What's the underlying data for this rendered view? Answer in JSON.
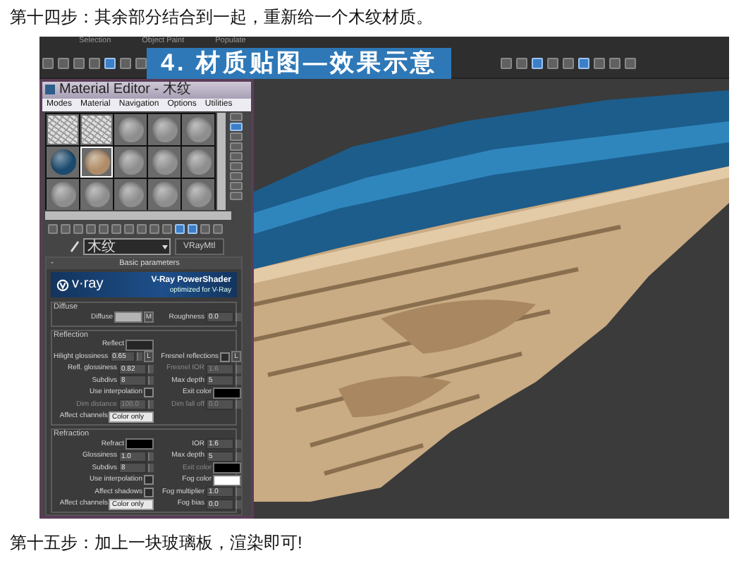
{
  "heading": "第十四步：其余部分结合到一起，重新给一个木纹材质。",
  "figure": {
    "banner": "4. 材质贴图—效果示意",
    "ribbon_tabs": [
      "Selection",
      "Object Paint",
      "Populate"
    ],
    "material_editor": {
      "title": "Material Editor - 木纹",
      "menu": [
        "Modes",
        "Material",
        "Navigation",
        "Options",
        "Utilities"
      ],
      "slots": [
        {
          "kind": "texture",
          "selected": false
        },
        {
          "kind": "texture",
          "selected": false
        },
        {
          "kind": "sphere",
          "color": "#8e8e8e",
          "selected": false
        },
        {
          "kind": "sphere",
          "color": "#8e8e8e",
          "selected": false
        },
        {
          "kind": "sphere",
          "color": "#8e8e8e",
          "selected": false
        },
        {
          "kind": "sphere",
          "color": "#1b4a6e",
          "selected": false
        },
        {
          "kind": "sphere",
          "color": "#b08d68",
          "selected": true
        },
        {
          "kind": "sphere",
          "color": "#8e8e8e",
          "selected": false
        },
        {
          "kind": "sphere",
          "color": "#8e8e8e",
          "selected": false
        },
        {
          "kind": "sphere",
          "color": "#8e8e8e",
          "selected": false
        },
        {
          "kind": "sphere",
          "color": "#8e8e8e",
          "selected": false
        },
        {
          "kind": "sphere",
          "color": "#8e8e8e",
          "selected": false
        },
        {
          "kind": "sphere",
          "color": "#8e8e8e",
          "selected": false
        },
        {
          "kind": "sphere",
          "color": "#8e8e8e",
          "selected": false
        },
        {
          "kind": "sphere",
          "color": "#8e8e8e",
          "selected": false
        }
      ],
      "material_name": "木纹",
      "material_type": "VRayMtl",
      "rollout": {
        "sign": "-",
        "title": "Basic parameters"
      },
      "vray_banner": {
        "logo": "v·ray",
        "title": "V-Ray PowerShader",
        "subtitle": "optimized for V-Ray"
      },
      "groups": [
        {
          "title": "Diffuse",
          "rows": [
            [
              {
                "label": "Diffuse",
                "kind": "color",
                "color": "#b4b4b4",
                "button": "M",
                "disabled": false
              },
              {
                "label": "Roughness",
                "kind": "spinner",
                "value": "0.0",
                "disabled": false
              }
            ]
          ]
        },
        {
          "title": "Reflection",
          "rows": [
            [
              {
                "label": "Reflect",
                "kind": "color",
                "color": "#262626",
                "disabled": false
              }
            ],
            [
              {
                "label": "Hilight glossiness",
                "kind": "spinner",
                "value": "0.65",
                "button": "L",
                "disabled": false
              },
              {
                "label": "Fresnel reflections",
                "kind": "check",
                "checked": false,
                "button": "L",
                "disabled": false
              }
            ],
            [
              {
                "label": "Refl. glossiness",
                "kind": "spinner",
                "value": "0.82",
                "disabled": false
              },
              {
                "label": "Fresnel IOR",
                "kind": "spinner",
                "value": "1.6",
                "disabled": true
              }
            ],
            [
              {
                "label": "Subdivs",
                "kind": "spinner",
                "value": "8",
                "disabled": false
              },
              {
                "label": "Max depth",
                "kind": "spinner",
                "value": "5",
                "disabled": false
              }
            ],
            [
              {
                "label": "Use interpolation",
                "kind": "check",
                "checked": false,
                "disabled": false
              },
              {
                "label": "Exit color",
                "kind": "color",
                "color": "#000000",
                "disabled": false
              }
            ],
            [
              {
                "label": "Dim distance",
                "kind": "spinner",
                "value": "100.0",
                "disabled": true
              },
              {
                "label": "Dim fall off",
                "kind": "spinner",
                "value": "0.0",
                "disabled": true
              }
            ],
            [
              {
                "label": "Affect channels",
                "kind": "dropdown",
                "value": "Color only",
                "disabled": false
              }
            ]
          ]
        },
        {
          "title": "Refraction",
          "rows": [
            [
              {
                "label": "Refract",
                "kind": "color",
                "color": "#000000",
                "disabled": false
              },
              {
                "label": "IOR",
                "kind": "spinner",
                "value": "1.6",
                "disabled": false
              }
            ],
            [
              {
                "label": "Glossiness",
                "kind": "spinner",
                "value": "1.0",
                "disabled": false
              },
              {
                "label": "Max depth",
                "kind": "spinner",
                "value": "5",
                "disabled": false
              }
            ],
            [
              {
                "label": "Subdivs",
                "kind": "spinner",
                "value": "8",
                "disabled": false
              },
              {
                "label": "Exit color",
                "kind": "color",
                "color": "#000000",
                "disabled": true
              }
            ],
            [
              {
                "label": "Use interpolation",
                "kind": "check",
                "checked": false,
                "disabled": false
              },
              {
                "label": "Fog color",
                "kind": "color",
                "color": "#ffffff",
                "disabled": false
              }
            ],
            [
              {
                "label": "Affect shadows",
                "kind": "check",
                "checked": false,
                "disabled": false
              },
              {
                "label": "Fog multiplier",
                "kind": "spinner",
                "value": "1.0",
                "disabled": false
              }
            ],
            [
              {
                "label": "Affect channels",
                "kind": "dropdown",
                "value": "Color only",
                "disabled": false
              },
              {
                "label": "Fog bias",
                "kind": "spinner",
                "value": "0.0",
                "disabled": false
              }
            ]
          ]
        }
      ]
    }
  },
  "footer": "第十五步：加上一块玻璃板，渲染即可!"
}
